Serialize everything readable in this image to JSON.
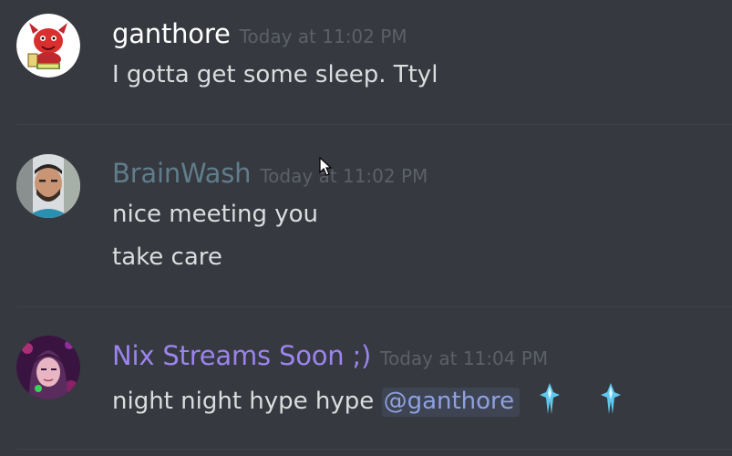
{
  "messages": [
    {
      "author": "ganthore",
      "author_color": "#ffffff",
      "timestamp": "Today at 11:02 PM",
      "lines": [
        "I gotta get some sleep. Ttyl"
      ]
    },
    {
      "author": "BrainWash",
      "author_color": "#607d8b",
      "timestamp": "Today at 11:02 PM",
      "lines": [
        "nice meeting you",
        "take care"
      ]
    },
    {
      "author": "Nix Streams Soon ;)",
      "author_color": "#9b84ee",
      "timestamp": "Today at 11:04 PM",
      "text_before_mention": "night night hype hype",
      "mention": "@ganthore",
      "emojis": [
        "sparkle-emoji-icon",
        "sparkle-emoji-icon"
      ]
    }
  ],
  "colors": {
    "background": "#36393f",
    "message_text": "#dcddde",
    "timestamp": "#5c6067",
    "mention_text": "#8ea1e1",
    "mention_bg": "#3e4452"
  }
}
